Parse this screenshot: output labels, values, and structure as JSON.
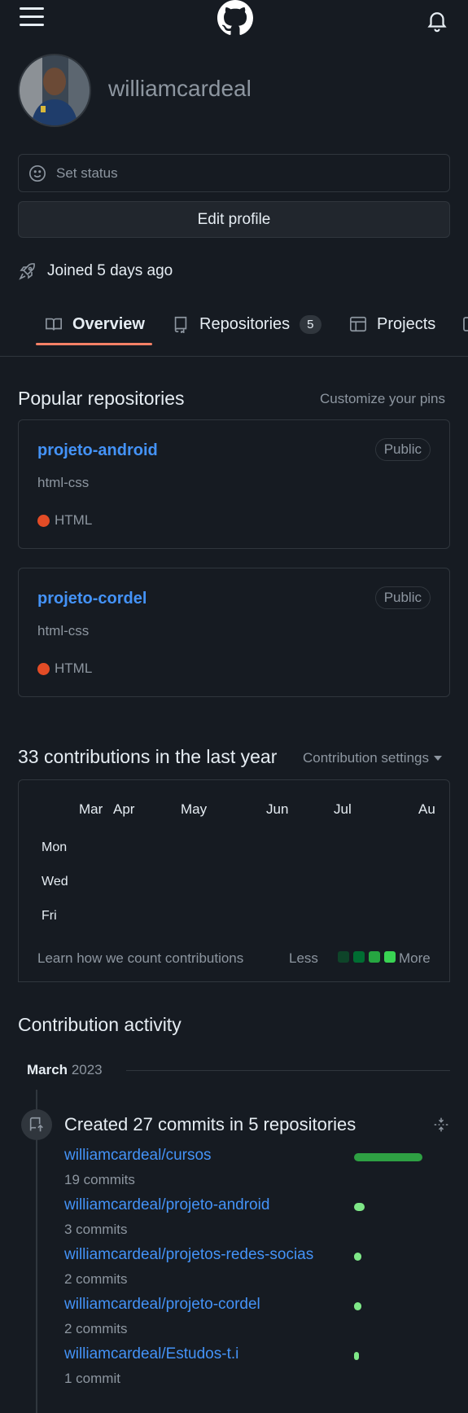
{
  "header": {
    "menu_icon": "hamburger-menu-icon",
    "logo_icon": "github-mark-icon",
    "notification_icon": "bell-icon"
  },
  "profile": {
    "username": "williamcardeal",
    "status_placeholder": "Set status",
    "edit_label": "Edit profile",
    "joined": "Joined 5 days ago"
  },
  "tabs": [
    {
      "label": "Overview",
      "icon": "book-icon",
      "active": true
    },
    {
      "label": "Repositories",
      "icon": "repo-icon",
      "count": "5"
    },
    {
      "label": "Projects",
      "icon": "table-icon"
    }
  ],
  "popular": {
    "title": "Popular repositories",
    "customize": "Customize your pins",
    "repos": [
      {
        "name": "projeto-android",
        "visibility": "Public",
        "description": "html-css",
        "language": "HTML",
        "lang_color": "#e34c26"
      },
      {
        "name": "projeto-cordel",
        "visibility": "Public",
        "description": "html-css",
        "language": "HTML",
        "lang_color": "#e34c26"
      }
    ]
  },
  "contributions": {
    "title": "33 contributions in the last year",
    "settings": "Contribution settings",
    "months": [
      "Mar",
      "Apr",
      "May",
      "Jun",
      "Jul",
      "Au"
    ],
    "days": [
      "Mon",
      "Wed",
      "Fri"
    ],
    "learn": "Learn how we count contributions",
    "less": "Less",
    "more": "More",
    "legend_colors": [
      "#0e4429",
      "#006d32",
      "#26a641",
      "#39d353"
    ]
  },
  "activity": {
    "title": "Contribution activity",
    "month": "March",
    "year": "2023",
    "summary": "Created 27 commits in 5 repositories",
    "commit_icon": "repo-push-icon",
    "collapse_icon": "fold-icon",
    "max_commits": 19,
    "rows": [
      {
        "repo": "williamcardeal/cursos",
        "count_label": "19 commits",
        "commits": 19
      },
      {
        "repo": "williamcardeal/projeto-android",
        "count_label": "3 commits",
        "commits": 3
      },
      {
        "repo": "williamcardeal/projetos-redes-socias",
        "count_label": "2 commits",
        "commits": 2
      },
      {
        "repo": "williamcardeal/projeto-cordel",
        "count_label": "2 commits",
        "commits": 2
      },
      {
        "repo": "williamcardeal/Estudos-t.i",
        "count_label": "1 commit",
        "commits": 1
      }
    ]
  }
}
